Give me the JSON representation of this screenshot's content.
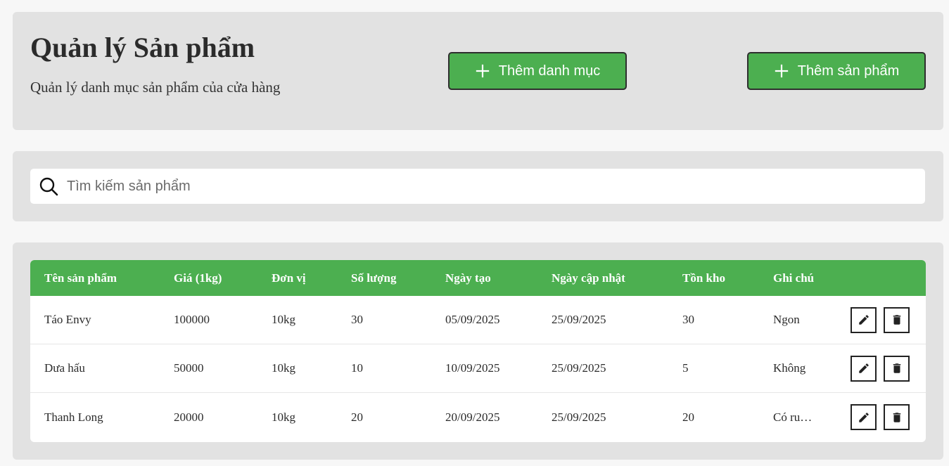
{
  "header": {
    "title": "Quản lý Sản phẩm",
    "subtitle": "Quản lý danh mục sản phẩm của cửa hàng",
    "add_category_label": "Thêm danh mục",
    "add_product_label": "Thêm sản phẩm"
  },
  "search": {
    "placeholder": "Tìm kiếm sản phẩm",
    "value": ""
  },
  "table": {
    "columns": [
      "Tên sản phẩm",
      "Giá (1kg)",
      "Đơn vị",
      "Số lượng",
      "Ngày tạo",
      "Ngày cập nhật",
      "Tồn kho",
      "Ghi chú"
    ],
    "rows": [
      [
        "Táo Envy",
        "100000",
        "10kg",
        "30",
        "05/09/2025",
        "25/09/2025",
        "30",
        "Ngon"
      ],
      [
        "Dưa hấu",
        "50000",
        "10kg",
        "10",
        "10/09/2025",
        "25/09/2025",
        "5",
        "Không"
      ],
      [
        "Thanh Long",
        "20000",
        "10kg",
        "20",
        "20/09/2025",
        "25/09/2025",
        "20",
        "Có ru…"
      ]
    ]
  },
  "icons": {
    "add": "plus-icon",
    "search": "search-icon",
    "edit": "pencil-icon",
    "delete": "trash-icon"
  },
  "colors": {
    "accent": "#4caf50",
    "panel": "#e2e2e2",
    "background": "#f7f7f7"
  }
}
